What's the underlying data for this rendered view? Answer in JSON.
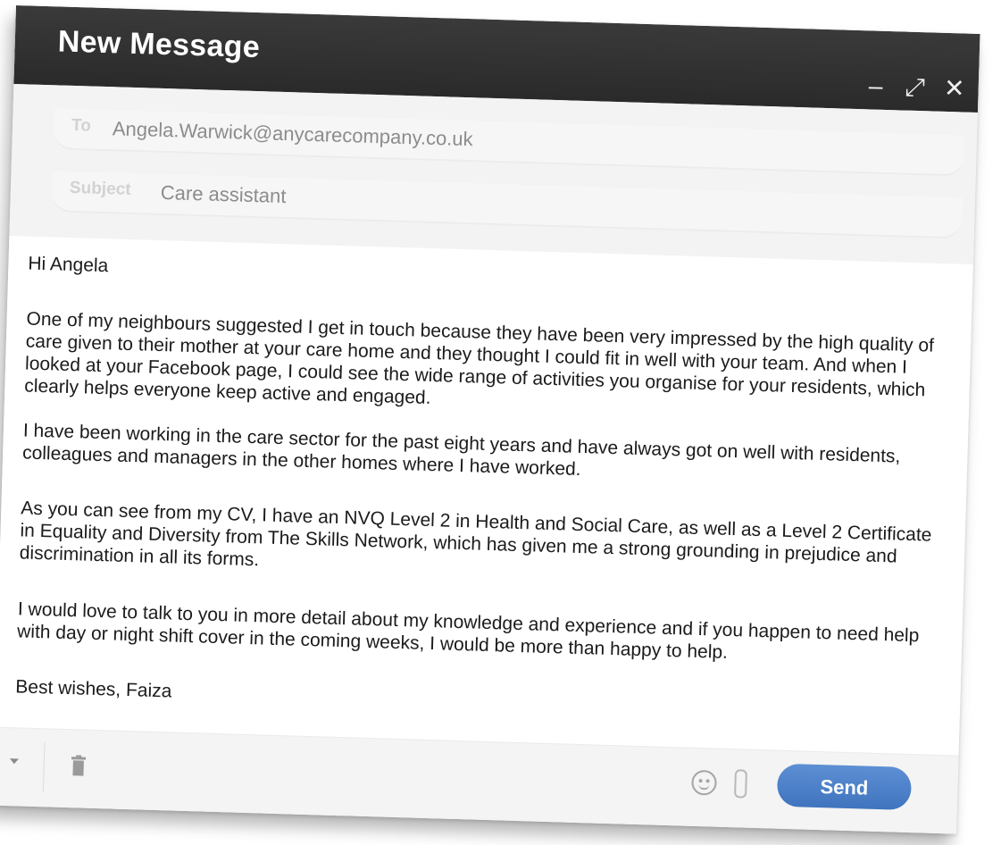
{
  "window": {
    "title": "New Message",
    "controls": {
      "minimize": "–",
      "expand": "⤢",
      "close": "✕"
    }
  },
  "fields": {
    "to_label": "To",
    "to_value": "Angela.Warwick@anycarecompany.co.uk",
    "subject_label": "Subject",
    "subject_value": "Care assistant"
  },
  "body": {
    "greeting": "Hi Angela",
    "paragraph_1": "One of my neighbours suggested I get in touch because they have been very impressed by the high quality of care given to their mother at your care home and they thought I could fit in well with your team. And when I looked at your Facebook page, I could see the wide range of activities you organise for your residents, which clearly helps everyone keep active and engaged.",
    "paragraph_2": "I have been working in the care sector for the past eight years and have always got on well with residents, colleagues and managers in the other homes where I have worked.",
    "paragraph_3": "As you can see from my CV, I have an NVQ Level 2 in Health and Social Care, as well as a Level 2 Certificate in Equality and Diversity from The Skills Network, which has given me a strong grounding in prejudice and discrimination in all its forms.",
    "paragraph_4": "I would love to talk to you in more detail about my knowledge and experience and if you happen to need help with day or night shift cover in the coming weeks, I would be more than happy to help.",
    "signoff": "Best wishes, Faiza"
  },
  "footer": {
    "send_label": "Send",
    "icons": [
      "dropdown-arrow-icon",
      "trash-icon",
      "emoji-icon",
      "paperclip-icon"
    ]
  },
  "colors": {
    "titlebar": "#2f2f2f",
    "send_button": "#4a7fc8"
  }
}
